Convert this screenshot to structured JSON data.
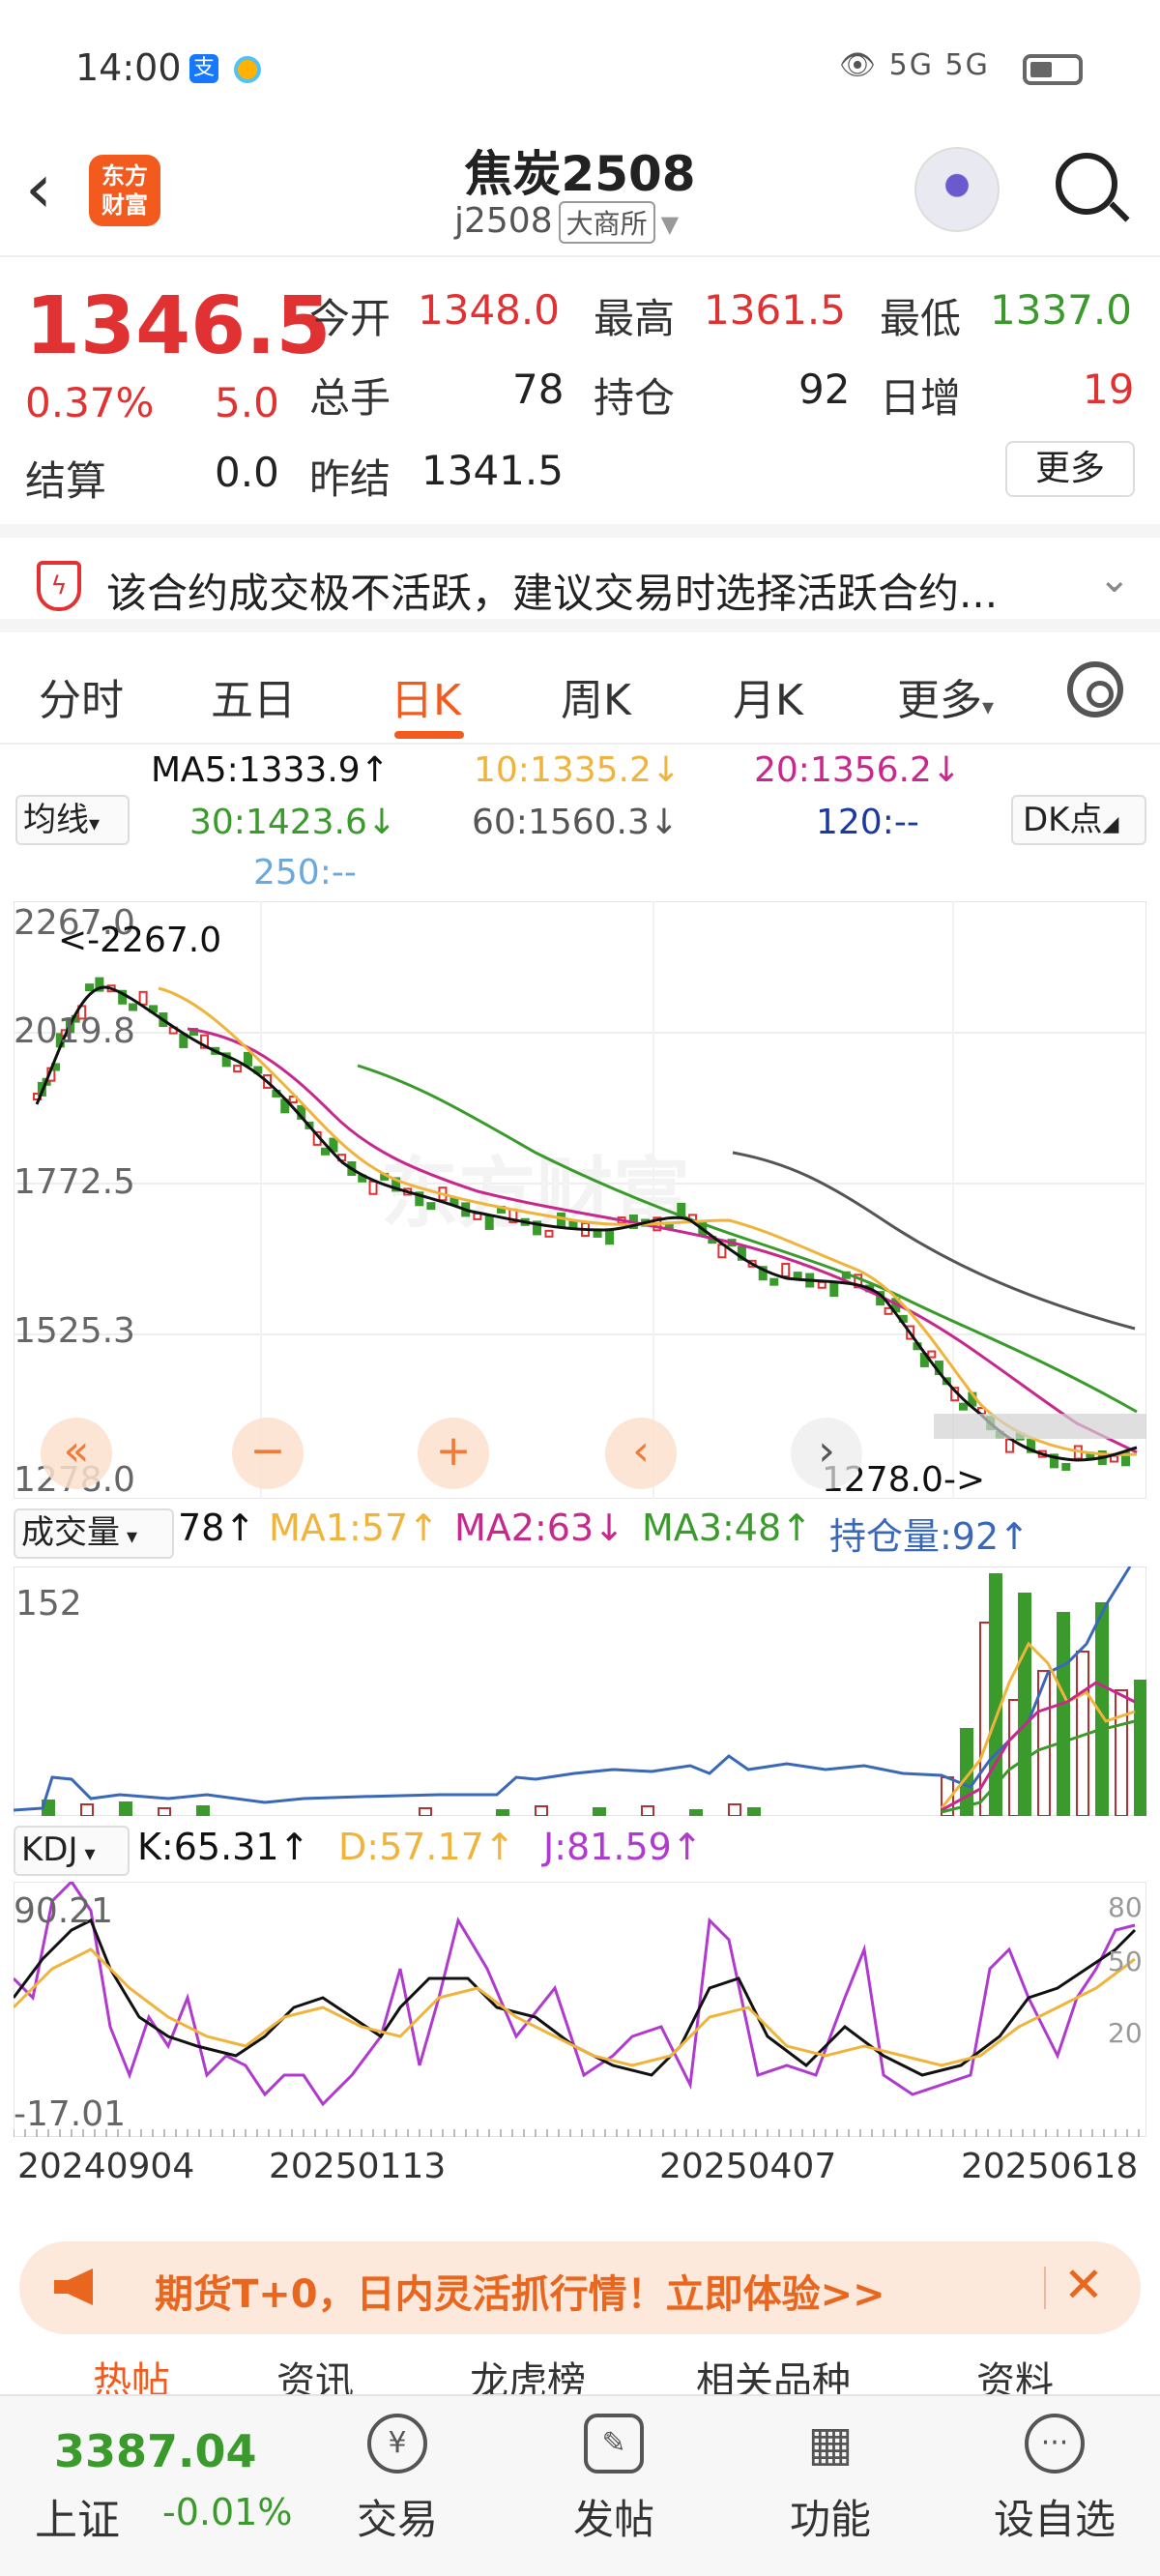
{
  "status_bar": {
    "time": "14:00",
    "app1": "支",
    "network": "5G  5G"
  },
  "header": {
    "logo": "东方\n财富",
    "title": "焦炭2508",
    "code": "j2508",
    "exchange": "大商所"
  },
  "quote": {
    "price": "1346.5",
    "pct_change": "0.37%",
    "change": "5.0",
    "settle_label": "结算",
    "settle": "0.0",
    "open_label": "今开",
    "open": "1348.0",
    "high_label": "最高",
    "high": "1361.5",
    "low_label": "最低",
    "low": "1337.0",
    "volume_label": "总手",
    "volume": "78",
    "oi_label": "持仓",
    "oi": "92",
    "oi_chg_label": "日增",
    "oi_chg": "19",
    "prev_settle_label": "昨结",
    "prev_settle": "1341.5",
    "more": "更多"
  },
  "notice": {
    "text": "该合约成交极不活跃，建议交易时选择活跃合约..."
  },
  "tabs": [
    "分时",
    "五日",
    "日K",
    "周K",
    "月K",
    "更多"
  ],
  "ma_legend": {
    "button": "均线",
    "ma5": "MA5:1333.9↑",
    "ma10": "10:1335.2↓",
    "ma20": "20:1356.2↓",
    "ma30": "30:1423.6↓",
    "ma60": "60:1560.3↓",
    "ma120": "120:--",
    "ma250": "250:--",
    "dk_button": "DK点"
  },
  "colors": {
    "up": "#e03232",
    "down": "#3a9a2c",
    "accent": "#f25a1e",
    "ma5": "#111111",
    "ma10": "#f0b43c",
    "ma20": "#c8288c",
    "ma30": "#3a9a2c",
    "ma60": "#555555",
    "ma120": "#1a3aa0",
    "ma250": "#6aa8e0"
  },
  "price_chart": {
    "y_ticks": [
      "2267.0",
      "2019.8",
      "1772.5",
      "1525.3",
      "1278.0"
    ],
    "max_label": "<-2267.0",
    "min_label": "1278.0->"
  },
  "volume_panel": {
    "button": "成交量",
    "vol": "78↑",
    "ma1": "MA1:57↑",
    "ma2": "MA2:63↓",
    "ma3": "MA3:48↑",
    "oi": "持仓量:92↑",
    "y_max": "152"
  },
  "kdj_panel": {
    "button": "KDJ",
    "k": "K:65.31↑",
    "d": "D:57.17↑",
    "j": "J:81.59↑",
    "y_max": "90.21",
    "y_min": "-17.01",
    "ref_80": "80",
    "ref_50": "50",
    "ref_20": "20"
  },
  "dates": [
    "20240904",
    "20250113",
    "20250407",
    "20250618"
  ],
  "promo": {
    "text": "期货T+0，日内灵活抓行情！立即体验>>"
  },
  "bottom_peek": [
    "热帖",
    "资讯",
    "龙虎榜",
    "相关品种",
    "资料"
  ],
  "bottom_nav": {
    "index_value": "3387.04",
    "index_name": "上证",
    "index_change": "-0.01%",
    "items": [
      "交易",
      "发帖",
      "功能",
      "设自选"
    ]
  }
}
